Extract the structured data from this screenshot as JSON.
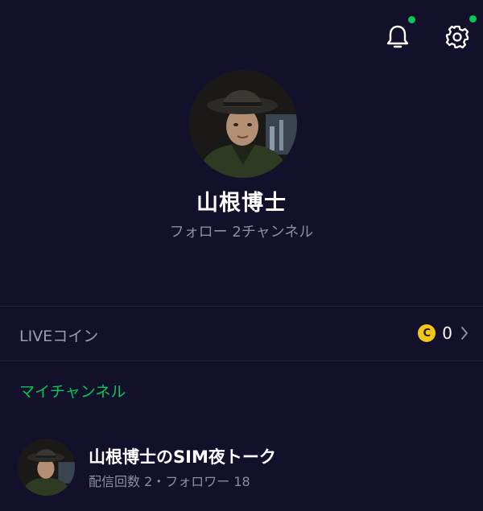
{
  "header": {
    "notification_icon": "bell-icon",
    "settings_icon": "gear-icon",
    "badge_color": "#06c755"
  },
  "profile": {
    "name": "山根博士",
    "follow_text": "フォロー 2チャンネル"
  },
  "coins": {
    "label": "LIVEコイン",
    "coin_symbol": "C",
    "value": "0",
    "chevron_icon": "chevron-right-icon"
  },
  "my_channel": {
    "title": "マイチャンネル",
    "channels": [
      {
        "name": "山根博士のSIM夜トーク",
        "meta": "配信回数 2・フォロワー 18"
      }
    ]
  },
  "colors": {
    "background": "#12102a",
    "accent": "#06c755",
    "coin": "#f5c518"
  }
}
